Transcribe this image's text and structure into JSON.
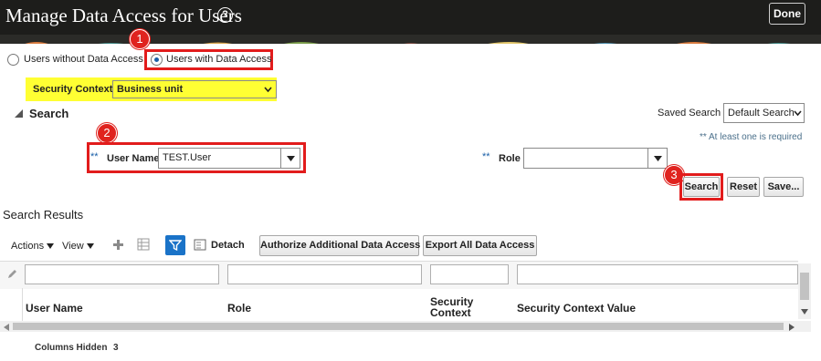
{
  "header": {
    "title": "Manage Data Access for Users",
    "help_icon": "?",
    "done_label": "Done"
  },
  "access_mode": {
    "option_without": "Users without Data Access",
    "option_with": "Users with Data Access",
    "selected": "option_with"
  },
  "security_context": {
    "label": "Security Context",
    "value": "Business unit"
  },
  "search": {
    "section_title": "Search",
    "saved_search_label": "Saved Search",
    "saved_search_value": "Default Search",
    "required_note": "** At least one is required",
    "required_marker": "**",
    "user_name_label": "User Name",
    "user_name_value": "TEST.User",
    "role_label": "Role",
    "role_value": "",
    "search_button": "Search",
    "reset_button": "Reset",
    "save_button": "Save..."
  },
  "callouts": {
    "step1": "1",
    "step2": "2",
    "step3": "3"
  },
  "results": {
    "title": "Search Results",
    "actions_menu": "Actions",
    "view_menu": "View",
    "detach_label": "Detach",
    "authorize_button": "Authorize Additional Data Access",
    "export_button": "Export All Data Access",
    "columns": [
      "User Name",
      "Role",
      "Security Context",
      "Security Context Value"
    ],
    "columns_hidden_label": "Columns Hidden",
    "columns_hidden_count": "3"
  },
  "colors": {
    "header_bg": "#1d1d1b",
    "highlight_yellow": "#ffff33",
    "callout_red": "#e21c1c",
    "accent_blue": "#1a73c8"
  }
}
